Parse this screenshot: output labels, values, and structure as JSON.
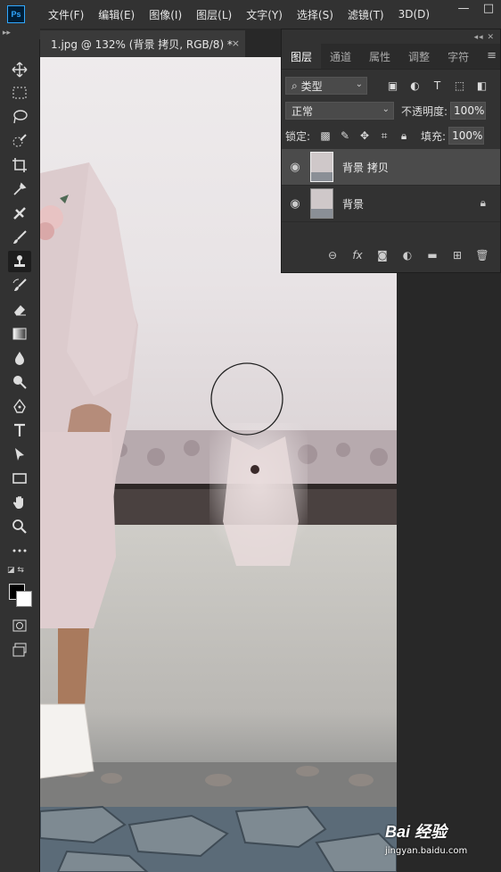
{
  "app": {
    "logo": "Ps"
  },
  "menu": [
    "文件(F)",
    "编辑(E)",
    "图像(I)",
    "图层(L)",
    "文字(Y)",
    "选择(S)",
    "滤镜(T)",
    "3D(D)"
  ],
  "window_controls": [
    "—",
    "□"
  ],
  "document_tab": {
    "title": "1.jpg @ 132% (背景 拷贝, RGB/8) *",
    "close": "×"
  },
  "tools": [
    "move-icon",
    "marquee-icon",
    "lasso-icon",
    "quick-select-icon",
    "crop-icon",
    "eyedropper-icon",
    "healing-icon",
    "brush-icon",
    "clone-stamp-icon",
    "history-brush-icon",
    "eraser-icon",
    "gradient-icon",
    "blur-icon",
    "dodge-icon",
    "pen-icon",
    "type-icon",
    "path-select-icon",
    "rectangle-icon",
    "hand-icon",
    "zoom-icon",
    "more-icon"
  ],
  "active_tool": "clone-stamp-icon",
  "colors": {
    "foreground": "#000000",
    "background": "#ffffff",
    "accent": "#31a8ff"
  },
  "layers_panel": {
    "tabs": [
      "图层",
      "通道",
      "属性",
      "调整",
      "字符"
    ],
    "active_tab": "图层",
    "filter": {
      "label": "类型",
      "search_glyph": "⌕"
    },
    "blend_mode": "正常",
    "opacity_label": "不透明度:",
    "opacity_value": "100%",
    "lock_label": "锁定:",
    "fill_label": "填充:",
    "fill_value": "100%",
    "layers": [
      {
        "name": "背景 拷贝",
        "visible": true,
        "selected": true,
        "locked": false
      },
      {
        "name": "背景",
        "visible": true,
        "selected": false,
        "locked": true
      }
    ]
  },
  "watermark": {
    "brand": "Bai 经验",
    "url": "jingyan.baidu.com"
  }
}
